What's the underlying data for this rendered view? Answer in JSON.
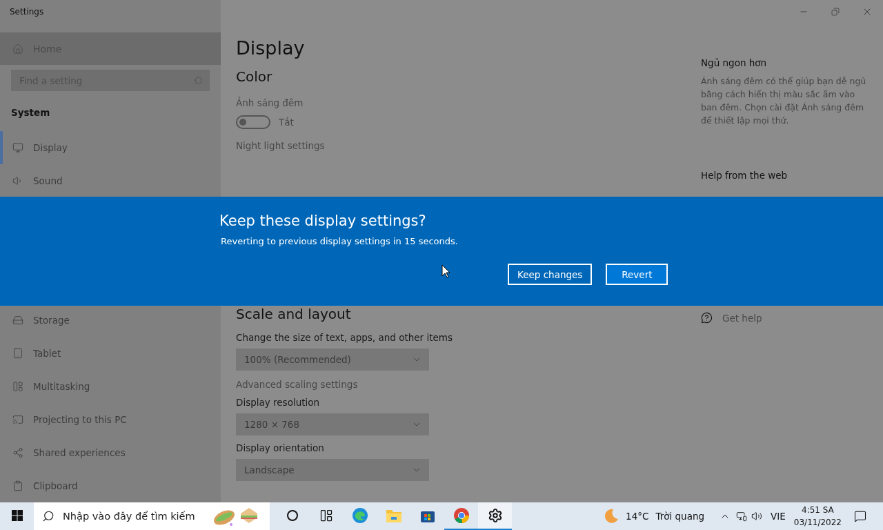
{
  "window": {
    "title": "Settings"
  },
  "sidebar": {
    "home": "Home",
    "search": {
      "placeholder": "Find a setting"
    },
    "section": "System",
    "items": [
      {
        "label": "Display",
        "kind": "monitor",
        "selected": true
      },
      {
        "label": "Sound",
        "kind": "speaker",
        "selected": false
      },
      {
        "kind": "gap"
      },
      {
        "label": "Storage",
        "kind": "storage",
        "selected": false
      },
      {
        "label": "Tablet",
        "kind": "tablet",
        "selected": false
      },
      {
        "label": "Multitasking",
        "kind": "multitask",
        "selected": false
      },
      {
        "label": "Projecting to this PC",
        "kind": "project",
        "selected": false
      },
      {
        "label": "Shared experiences",
        "kind": "share",
        "selected": false
      },
      {
        "label": "Clipboard",
        "kind": "clipboard",
        "selected": false
      }
    ]
  },
  "main": {
    "title": "Display",
    "color_heading": "Color",
    "night_light": {
      "label": "Ảnh sáng đêm",
      "state_text": "Tắt",
      "on": false
    },
    "night_link": "Night light settings",
    "scale_heading": "Scale and layout",
    "scale_items": [
      {
        "kind": "dropdown",
        "label": "Change the size of text, apps, and other items",
        "value": "100% (Recommended)"
      },
      {
        "kind": "link",
        "label": "Advanced scaling settings"
      },
      {
        "kind": "dropdown",
        "label": "Display resolution",
        "value": "1280 × 768"
      },
      {
        "kind": "dropdown",
        "label": "Display orientation",
        "value": "Landscape"
      }
    ]
  },
  "aside": {
    "heading": "Ngủ ngon hơn",
    "text": "Ánh sáng đêm có thể giúp bạn dễ ngủ bằng cách hiển thị màu sắc ấm vào ban đêm. Chọn cài đặt Ánh sáng đêm để thiết lập mọi thứ.",
    "help_heading": "Help from the web",
    "get_help": "Get help"
  },
  "dialog": {
    "title": "Keep these display settings?",
    "message": "Reverting to previous display settings in 15 seconds.",
    "buttons": [
      {
        "label": "Keep changes",
        "default": false
      },
      {
        "label": "Revert",
        "default": true
      }
    ]
  },
  "taskbar": {
    "search": {
      "placeholder": "Nhập vào đây để tìm kiếm"
    },
    "apps": [
      {
        "kind": "cortana",
        "running": false,
        "active": false
      },
      {
        "kind": "taskview",
        "running": false,
        "active": false
      },
      {
        "kind": "edge",
        "running": false,
        "active": false
      },
      {
        "kind": "explorer",
        "running": false,
        "active": false
      },
      {
        "kind": "store",
        "running": false,
        "active": false
      },
      {
        "kind": "chrome",
        "running": true,
        "active": false
      },
      {
        "kind": "settings",
        "running": true,
        "active": true
      }
    ],
    "weather": {
      "temp": "14°C",
      "condition": "Trời quang"
    },
    "language": "VIE",
    "time": "4:51 SA",
    "date": "03/11/2022"
  }
}
